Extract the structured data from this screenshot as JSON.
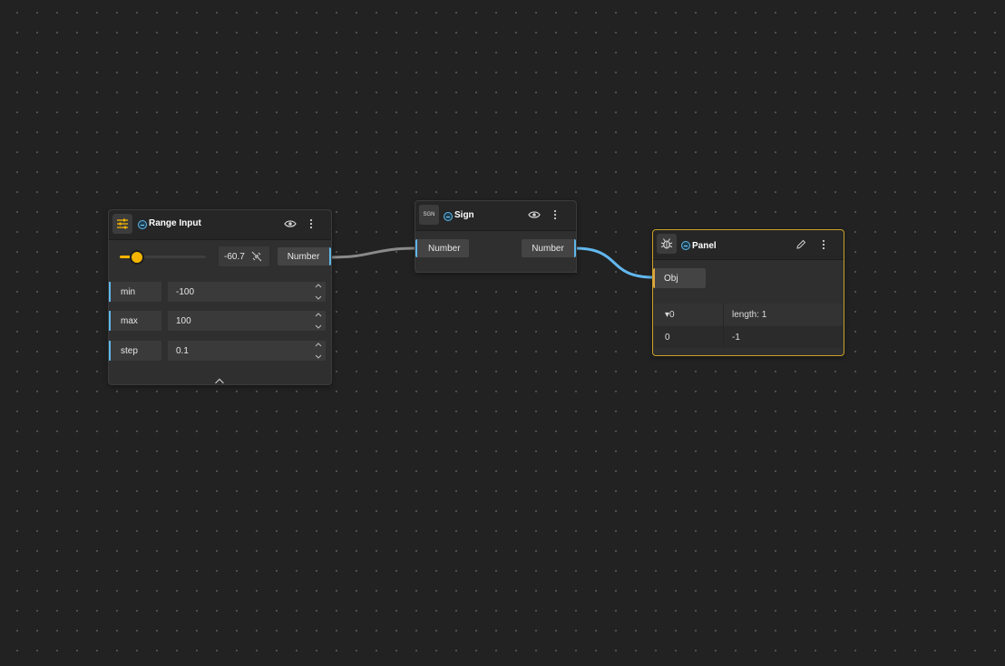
{
  "colors": {
    "background": "#222222",
    "node": "#2f2f2f",
    "port_accent": "#5fb7e8",
    "slider_accent": "#f4b400",
    "selected_border": "#c9a227",
    "wire_gray": "#8a8a8a",
    "wire_blue": "#62b8ee"
  },
  "range_input": {
    "title": "Range Input",
    "icon": "sliders-icon",
    "value": "-60.7",
    "value_ratio": 0.1965,
    "output_port": "Number",
    "params": [
      {
        "label": "min",
        "value": "-100"
      },
      {
        "label": "max",
        "value": "100"
      },
      {
        "label": "step",
        "value": "0.1"
      }
    ]
  },
  "sign": {
    "title": "Sign",
    "icon_text": "SGN",
    "input_port": "Number",
    "output_port": "Number"
  },
  "panel": {
    "title": "Panel",
    "icon": "bug-icon",
    "input_port": "Obj",
    "rows": [
      {
        "key": "▾0",
        "value": "length: 1"
      },
      {
        "key": "0",
        "value": "-1"
      }
    ]
  }
}
